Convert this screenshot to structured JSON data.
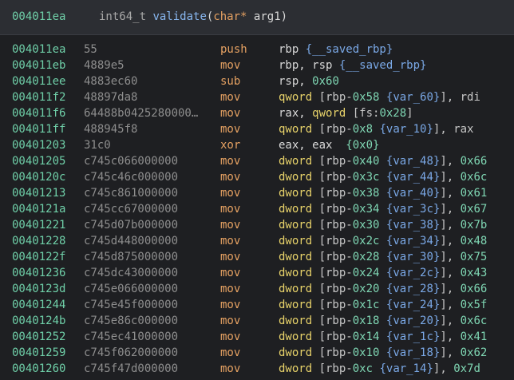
{
  "header": {
    "address": "004011ea",
    "return_type": "int64_t",
    "function_name": "validate",
    "paren_open": "(",
    "param_type": "char*",
    "param_rest": " arg1)"
  },
  "instructions": [
    {
      "addr": "004011ea",
      "bytes": "55",
      "mnemonic": "push",
      "tokens": [
        [
          "reg",
          "rbp "
        ],
        [
          "var",
          "{__saved_rbp}"
        ]
      ]
    },
    {
      "addr": "004011eb",
      "bytes": "4889e5",
      "mnemonic": "mov",
      "tokens": [
        [
          "reg",
          "rbp, rsp "
        ],
        [
          "var",
          "{__saved_rbp}"
        ]
      ]
    },
    {
      "addr": "004011ee",
      "bytes": "4883ec60",
      "mnemonic": "sub",
      "tokens": [
        [
          "reg",
          "rsp, "
        ],
        [
          "num",
          "0x60"
        ]
      ]
    },
    {
      "addr": "004011f2",
      "bytes": "48897da8",
      "mnemonic": "mov",
      "tokens": [
        [
          "kw",
          "qword "
        ],
        [
          "punc",
          "[rbp-"
        ],
        [
          "num",
          "0x58"
        ],
        [
          "punc",
          " "
        ],
        [
          "var",
          "{var_60}"
        ],
        [
          "punc",
          "], rdi"
        ]
      ]
    },
    {
      "addr": "004011f6",
      "bytes": "64488b0425280000…",
      "mnemonic": "mov",
      "tokens": [
        [
          "reg",
          "rax, "
        ],
        [
          "kw",
          "qword "
        ],
        [
          "punc",
          "[fs:"
        ],
        [
          "num",
          "0x28"
        ],
        [
          "punc",
          "]"
        ]
      ]
    },
    {
      "addr": "004011ff",
      "bytes": "488945f8",
      "mnemonic": "mov",
      "tokens": [
        [
          "kw",
          "qword "
        ],
        [
          "punc",
          "[rbp-"
        ],
        [
          "num",
          "0x8"
        ],
        [
          "punc",
          " "
        ],
        [
          "var",
          "{var_10}"
        ],
        [
          "punc",
          "], rax"
        ]
      ]
    },
    {
      "addr": "00401203",
      "bytes": "31c0",
      "mnemonic": "xor",
      "tokens": [
        [
          "reg",
          "eax, eax  "
        ],
        [
          "num",
          "{0x0}"
        ]
      ]
    },
    {
      "addr": "00401205",
      "bytes": "c745c066000000",
      "mnemonic": "mov",
      "tokens": [
        [
          "kw",
          "dword "
        ],
        [
          "punc",
          "[rbp-"
        ],
        [
          "num",
          "0x40"
        ],
        [
          "punc",
          " "
        ],
        [
          "var",
          "{var_48}"
        ],
        [
          "punc",
          "], "
        ],
        [
          "num",
          "0x66"
        ]
      ]
    },
    {
      "addr": "0040120c",
      "bytes": "c745c46c000000",
      "mnemonic": "mov",
      "tokens": [
        [
          "kw",
          "dword "
        ],
        [
          "punc",
          "[rbp-"
        ],
        [
          "num",
          "0x3c"
        ],
        [
          "punc",
          " "
        ],
        [
          "var",
          "{var_44}"
        ],
        [
          "punc",
          "], "
        ],
        [
          "num",
          "0x6c"
        ]
      ]
    },
    {
      "addr": "00401213",
      "bytes": "c745c861000000",
      "mnemonic": "mov",
      "tokens": [
        [
          "kw",
          "dword "
        ],
        [
          "punc",
          "[rbp-"
        ],
        [
          "num",
          "0x38"
        ],
        [
          "punc",
          " "
        ],
        [
          "var",
          "{var_40}"
        ],
        [
          "punc",
          "], "
        ],
        [
          "num",
          "0x61"
        ]
      ]
    },
    {
      "addr": "0040121a",
      "bytes": "c745cc67000000",
      "mnemonic": "mov",
      "tokens": [
        [
          "kw",
          "dword "
        ],
        [
          "punc",
          "[rbp-"
        ],
        [
          "num",
          "0x34"
        ],
        [
          "punc",
          " "
        ],
        [
          "var",
          "{var_3c}"
        ],
        [
          "punc",
          "], "
        ],
        [
          "num",
          "0x67"
        ]
      ]
    },
    {
      "addr": "00401221",
      "bytes": "c745d07b000000",
      "mnemonic": "mov",
      "tokens": [
        [
          "kw",
          "dword "
        ],
        [
          "punc",
          "[rbp-"
        ],
        [
          "num",
          "0x30"
        ],
        [
          "punc",
          " "
        ],
        [
          "var",
          "{var_38}"
        ],
        [
          "punc",
          "], "
        ],
        [
          "num",
          "0x7b"
        ]
      ]
    },
    {
      "addr": "00401228",
      "bytes": "c745d448000000",
      "mnemonic": "mov",
      "tokens": [
        [
          "kw",
          "dword "
        ],
        [
          "punc",
          "[rbp-"
        ],
        [
          "num",
          "0x2c"
        ],
        [
          "punc",
          " "
        ],
        [
          "var",
          "{var_34}"
        ],
        [
          "punc",
          "], "
        ],
        [
          "num",
          "0x48"
        ]
      ]
    },
    {
      "addr": "0040122f",
      "bytes": "c745d875000000",
      "mnemonic": "mov",
      "tokens": [
        [
          "kw",
          "dword "
        ],
        [
          "punc",
          "[rbp-"
        ],
        [
          "num",
          "0x28"
        ],
        [
          "punc",
          " "
        ],
        [
          "var",
          "{var_30}"
        ],
        [
          "punc",
          "], "
        ],
        [
          "num",
          "0x75"
        ]
      ]
    },
    {
      "addr": "00401236",
      "bytes": "c745dc43000000",
      "mnemonic": "mov",
      "tokens": [
        [
          "kw",
          "dword "
        ],
        [
          "punc",
          "[rbp-"
        ],
        [
          "num",
          "0x24"
        ],
        [
          "punc",
          " "
        ],
        [
          "var",
          "{var_2c}"
        ],
        [
          "punc",
          "], "
        ],
        [
          "num",
          "0x43"
        ]
      ]
    },
    {
      "addr": "0040123d",
      "bytes": "c745e066000000",
      "mnemonic": "mov",
      "tokens": [
        [
          "kw",
          "dword "
        ],
        [
          "punc",
          "[rbp-"
        ],
        [
          "num",
          "0x20"
        ],
        [
          "punc",
          " "
        ],
        [
          "var",
          "{var_28}"
        ],
        [
          "punc",
          "], "
        ],
        [
          "num",
          "0x66"
        ]
      ]
    },
    {
      "addr": "00401244",
      "bytes": "c745e45f000000",
      "mnemonic": "mov",
      "tokens": [
        [
          "kw",
          "dword "
        ],
        [
          "punc",
          "[rbp-"
        ],
        [
          "num",
          "0x1c"
        ],
        [
          "punc",
          " "
        ],
        [
          "var",
          "{var_24}"
        ],
        [
          "punc",
          "], "
        ],
        [
          "num",
          "0x5f"
        ]
      ]
    },
    {
      "addr": "0040124b",
      "bytes": "c745e86c000000",
      "mnemonic": "mov",
      "tokens": [
        [
          "kw",
          "dword "
        ],
        [
          "punc",
          "[rbp-"
        ],
        [
          "num",
          "0x18"
        ],
        [
          "punc",
          " "
        ],
        [
          "var",
          "{var_20}"
        ],
        [
          "punc",
          "], "
        ],
        [
          "num",
          "0x6c"
        ]
      ]
    },
    {
      "addr": "00401252",
      "bytes": "c745ec41000000",
      "mnemonic": "mov",
      "tokens": [
        [
          "kw",
          "dword "
        ],
        [
          "punc",
          "[rbp-"
        ],
        [
          "num",
          "0x14"
        ],
        [
          "punc",
          " "
        ],
        [
          "var",
          "{var_1c}"
        ],
        [
          "punc",
          "], "
        ],
        [
          "num",
          "0x41"
        ]
      ]
    },
    {
      "addr": "00401259",
      "bytes": "c745f062000000",
      "mnemonic": "mov",
      "tokens": [
        [
          "kw",
          "dword "
        ],
        [
          "punc",
          "[rbp-"
        ],
        [
          "num",
          "0x10"
        ],
        [
          "punc",
          " "
        ],
        [
          "var",
          "{var_18}"
        ],
        [
          "punc",
          "], "
        ],
        [
          "num",
          "0x62"
        ]
      ]
    },
    {
      "addr": "00401260",
      "bytes": "c745f47d000000",
      "mnemonic": "mov",
      "tokens": [
        [
          "kw",
          "dword "
        ],
        [
          "punc",
          "[rbp-"
        ],
        [
          "num",
          "0xc"
        ],
        [
          "punc",
          " "
        ],
        [
          "var",
          "{var_14}"
        ],
        [
          "punc",
          "], "
        ],
        [
          "num",
          "0x7d"
        ]
      ]
    }
  ]
}
